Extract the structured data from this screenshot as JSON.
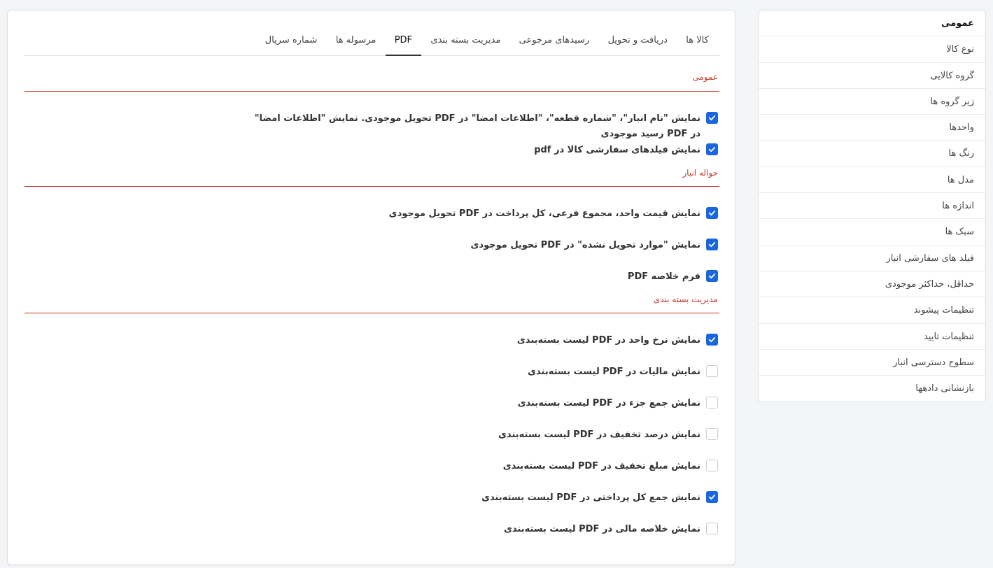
{
  "sidebar": {
    "items": [
      {
        "label": "عمومی",
        "active": true
      },
      {
        "label": "نوع کالا"
      },
      {
        "label": "گروه کالایی"
      },
      {
        "label": "زیر گروه ها"
      },
      {
        "label": "واحدها"
      },
      {
        "label": "رنگ ها"
      },
      {
        "label": "مدل ها"
      },
      {
        "label": "اندازه ها"
      },
      {
        "label": "سبک ها"
      },
      {
        "label": "فیلد های سفارشی انبار"
      },
      {
        "label": "حداقل، حداکثر موجودی"
      },
      {
        "label": "تنظیمات پیشوند"
      },
      {
        "label": "تنظیمات تایید"
      },
      {
        "label": "سطوح دسترسی انبار"
      },
      {
        "label": "بازنشانی دادهها"
      }
    ]
  },
  "tabs": [
    {
      "label": "کالا ها"
    },
    {
      "label": "دریافت و تحویل"
    },
    {
      "label": "رسیدهای مرجوعی"
    },
    {
      "label": "مدیریت بسته بندی"
    },
    {
      "label": "PDF",
      "active": true
    },
    {
      "label": "مرسوله ها"
    },
    {
      "label": "شماره سریال"
    }
  ],
  "sections": {
    "general": {
      "title": "عمومی",
      "options": [
        {
          "label": "نمایش \"نام انبار\"، \"شماره قطعه\"، \"اطلاعات امضا\" در PDF تحویل موجودی. نمایش \"اطلاعات امضا\" در PDF رسید موجودی",
          "checked": true
        },
        {
          "label": "نمایش فیلدهای سفارشی کالا در pdf",
          "checked": true
        }
      ]
    },
    "warehouse_transfer": {
      "title": "حواله انبار",
      "options": [
        {
          "label": "نمایش قیمت واحد، مجموع فرعی، کل پرداخت در PDF تحویل موجودی",
          "checked": true
        },
        {
          "label": "نمایش \"موارد تحویل نشده\" در PDF تحویل موجودی",
          "checked": true
        },
        {
          "label": "فرم خلاصه PDF",
          "checked": true
        }
      ]
    },
    "packaging": {
      "title": "مدیریت بسته بندی",
      "options": [
        {
          "label": "نمایش نرخ واحد در PDF لیست بسته‌بندی",
          "checked": true
        },
        {
          "label": "نمایش مالیات در PDF لیست بسته‌بندی",
          "checked": false
        },
        {
          "label": "نمایش جمع جزء در PDF لیست بسته‌بندی",
          "checked": false
        },
        {
          "label": "نمایش درصد تخفیف در PDF لیست بسته‌بندی",
          "checked": false
        },
        {
          "label": "نمایش مبلغ تخفیف در PDF لیست بسته‌بندی",
          "checked": false
        },
        {
          "label": "نمایش جمع کل پرداختی در PDF لیست بسته‌بندی",
          "checked": true
        },
        {
          "label": "نمایش خلاصه مالی در PDF لیست بسته‌بندی",
          "checked": false
        }
      ]
    }
  },
  "colors": {
    "accent": "#1a66e0",
    "section_title": "#c0392b"
  }
}
